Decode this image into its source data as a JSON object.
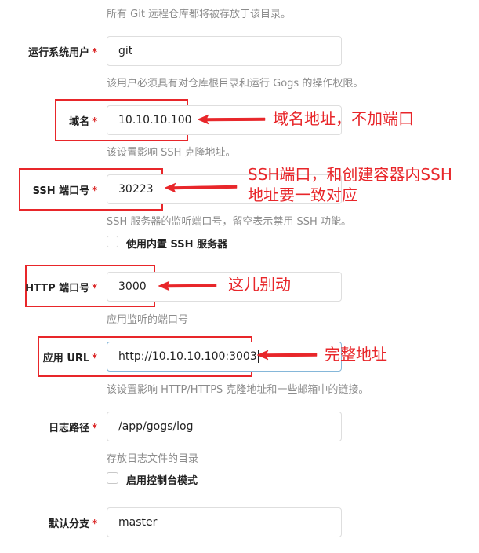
{
  "form": {
    "repo_root_hint": "所有 Git 远程仓库都将被存放于该目录。",
    "run_user": {
      "label": "运行系统用户",
      "required_mark": "*",
      "value": "git",
      "hint": "该用户必须具有对仓库根目录和运行 Gogs 的操作权限。"
    },
    "domain": {
      "label": "域名",
      "required_mark": "*",
      "value": "10.10.10.100",
      "hint": "该设置影响 SSH 克隆地址。"
    },
    "ssh_port": {
      "label": "SSH 端口号",
      "required_mark": "*",
      "value": "30223",
      "hint": "SSH 服务器的监听端口号，留空表示禁用 SSH 功能。"
    },
    "builtin_ssh": {
      "label": "使用内置 SSH 服务器",
      "checked": false
    },
    "http_port": {
      "label": "HTTP 端口号",
      "required_mark": "*",
      "value": "3000",
      "hint": "应用监听的端口号"
    },
    "app_url": {
      "label": "应用 URL",
      "required_mark": "*",
      "value": "http://10.10.10.100:3003",
      "hint": "该设置影响 HTTP/HTTPS 克隆地址和一些邮箱中的链接。"
    },
    "log_path": {
      "label": "日志路径",
      "required_mark": "*",
      "value": "/app/gogs/log",
      "hint": "存放日志文件的目录"
    },
    "console_mode": {
      "label": "启用控制台模式",
      "checked": false
    },
    "default_branch": {
      "label": "默认分支",
      "required_mark": "*",
      "value": "master"
    }
  },
  "annotations": {
    "domain_note": "域名地址，不加端口",
    "ssh_note_line1": "SSH端口，和创建容器内SSH",
    "ssh_note_line2": "地址要一致对应",
    "http_note": "这儿别动",
    "url_note": "完整地址",
    "color": "#e8262a"
  }
}
